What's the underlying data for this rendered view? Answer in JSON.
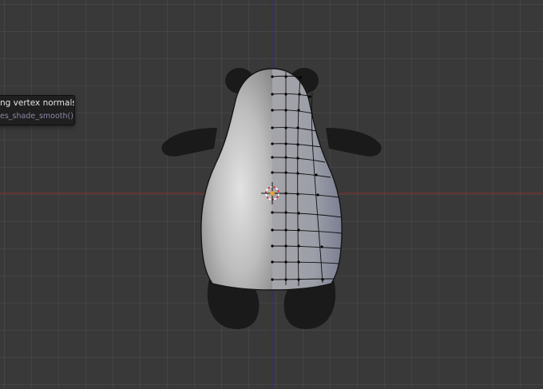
{
  "tooltip": {
    "line1": "ng vertex normals)",
    "line2": "es_shade_smooth()"
  },
  "colors": {
    "background": "#393939",
    "x_axis": "#8a2a2a",
    "z_axis": "#2a2a9a",
    "silhouette": "#1a1a1a",
    "mesh_light": "#d2d2d2",
    "mesh_shadow": "#8c8e98",
    "wireframe": "#000000"
  },
  "icons": {
    "cursor": "3d-cursor-icon"
  }
}
